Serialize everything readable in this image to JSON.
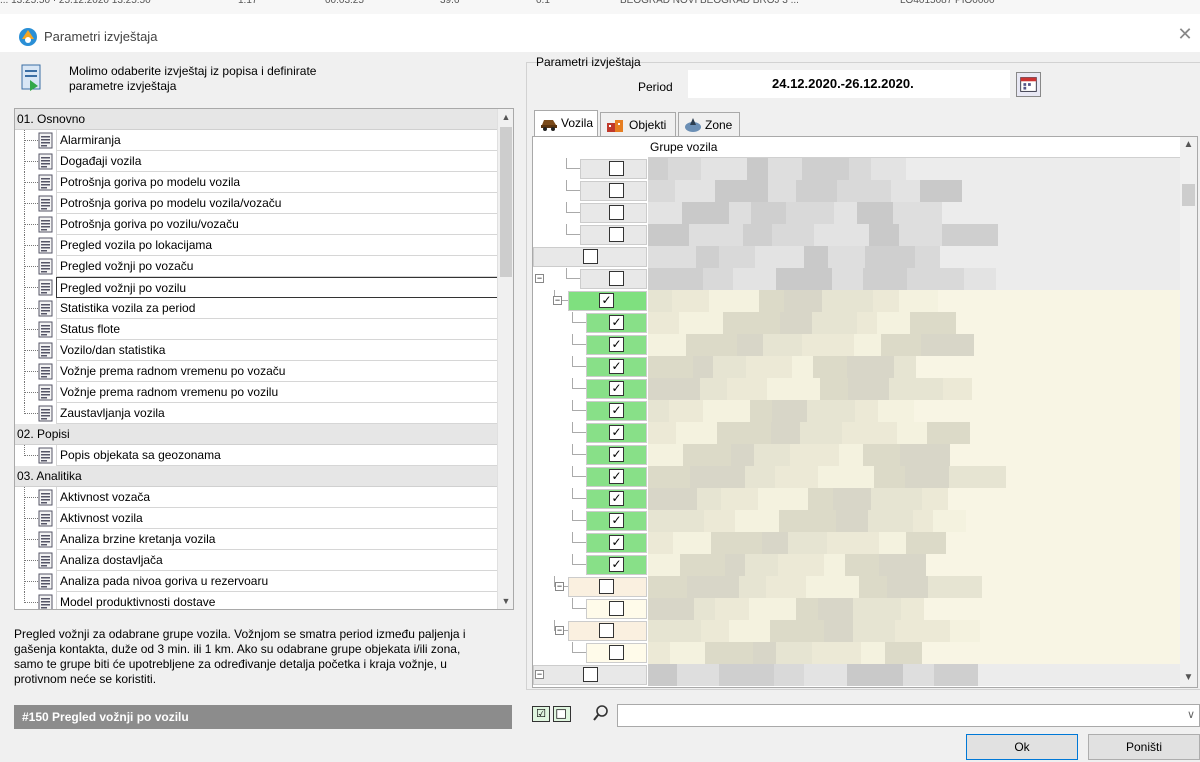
{
  "background_strip": {
    "fragments": [
      "... 13:25:50 · 25.12.2020 13:25:50",
      "1:17",
      "00:03:25",
      "39.6",
      "0.1",
      "BEOGRAD NOVI BEOGRAD BROJ 3 ...",
      "LO4015087 PIO0000"
    ]
  },
  "window": {
    "title": "Parametri izvještaja",
    "close_glyph": "✕"
  },
  "intro": {
    "text_line1": "Molimo odaberite izvještaj iz popisa i definirate",
    "text_line2": "parametre izvještaja"
  },
  "report_list": {
    "categories": [
      {
        "label": "01. Osnovno",
        "items": [
          "Alarmiranja",
          "Događaji vozila",
          "Potrošnja goriva po modelu vozila",
          "Potrošnja goriva po modelu vozila/vozaču",
          "Potrošnja goriva po vozilu/vozaču",
          "Pregled vozila po lokacijama",
          "Pregled vožnji po vozaču",
          "Pregled vožnji po vozilu",
          "Statistika vozila za period",
          "Status flote",
          "Vozilo/dan statistika",
          "Vožnje prema radnom vremenu po vozaču",
          "Vožnje prema radnom vremenu po vozilu",
          "Zaustavljanja vozila"
        ]
      },
      {
        "label": "02. Popisi",
        "items": [
          "Popis objekata sa geozonama"
        ]
      },
      {
        "label": "03. Analitika",
        "items": [
          "Aktivnost vozača",
          "Aktivnost vozila",
          "Analiza brzine kretanja vozila",
          "Analiza dostavljača",
          "Analiza pada nivoa goriva u rezervoaru",
          "Model produktivnosti dostave"
        ]
      }
    ],
    "selected": "Pregled vožnji po vozilu"
  },
  "description": {
    "lines": [
      "Pregled vožnji za odabrane grupe vozila. Vožnjom se smatra period između paljenja i",
      "gašenja kontakta, duže od 3 min. ili 1 km. Ako su odabrane grupe objekata i/ili zona,",
      "samo te grupe biti će upotrebljene za određivanje detalja početka i kraja vožnje, u",
      "protivnom neće se koristiti."
    ]
  },
  "status_bar": {
    "text": "#150 Pregled vožnji po vozilu"
  },
  "params": {
    "group_label": "Parametri izvještaja",
    "period_label": "Period",
    "period_value": "24.12.2020.-26.12.2020."
  },
  "tabs": [
    {
      "label": "Vozila",
      "active": true,
      "icon": "car-icon"
    },
    {
      "label": "Objekti",
      "active": false,
      "icon": "buildings-icon"
    },
    {
      "label": "Zone",
      "active": false,
      "icon": "zone-icon"
    }
  ],
  "tree": {
    "column_header": "Grupe vozila",
    "checkbox_states": [
      false,
      false,
      false,
      false,
      false,
      false,
      true,
      true,
      true,
      true,
      true,
      true,
      true,
      true,
      true,
      true,
      true,
      true,
      true,
      false,
      false,
      false,
      false,
      false
    ],
    "colors": {
      "checked_bg": "#88e088",
      "parent_bg": "#7fe07f",
      "group_bg": "#faf0e0",
      "sub_bg": "#fffbea",
      "unchecked_bg": "#e8e8e8"
    }
  },
  "buttons": {
    "ok": "Ok",
    "cancel": "Poništi"
  }
}
